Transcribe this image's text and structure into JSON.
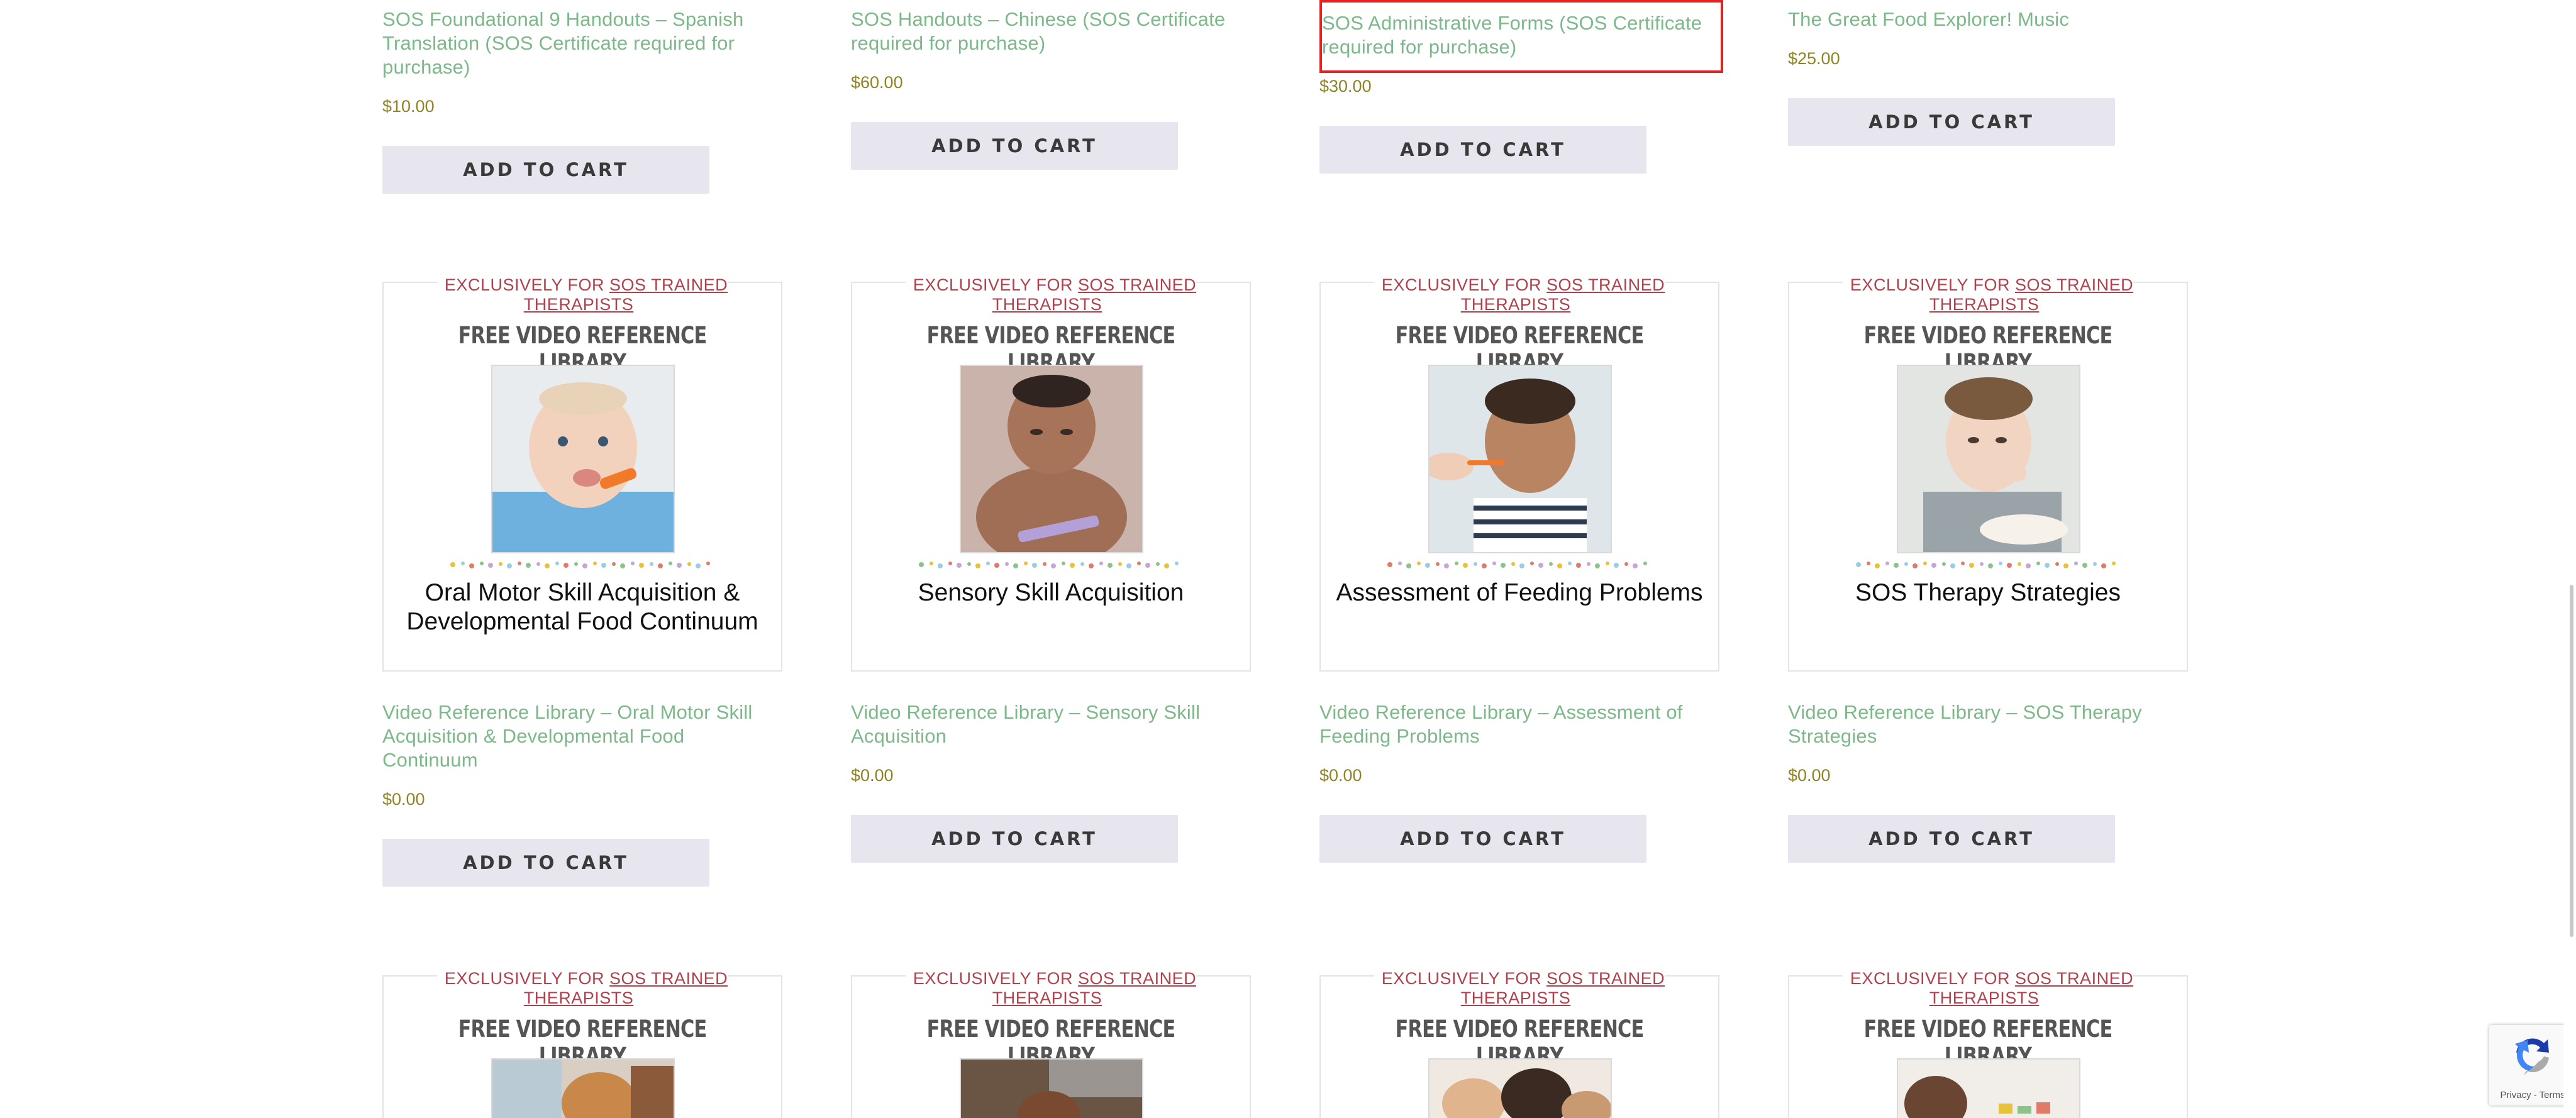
{
  "products_row1": [
    {
      "title": "SOS Foundational 9 Handouts – Spanish Translation (SOS Certificate required for purchase)",
      "price": "$10.00",
      "button": "ADD TO CART"
    },
    {
      "title": "SOS Handouts – Chinese (SOS Certificate required for purchase)",
      "price": "$60.00",
      "button": "ADD TO CART"
    },
    {
      "title": "SOS Administrative Forms (SOS Certificate required for purchase)",
      "price": "$30.00",
      "button": "ADD TO CART"
    },
    {
      "title": "The Great Food Explorer! Music",
      "price": "$25.00",
      "button": "ADD TO CART"
    }
  ],
  "products_row2": [
    {
      "exclusive_prefix": "EXCLUSIVELY FOR",
      "exclusive_link": "SOS TRAINED THERAPISTS",
      "library_title": "FREE VIDEO REFERENCE LIBRARY",
      "caption": "Oral Motor Skill Acquisition & Developmental Food Continuum",
      "title": "Video Reference Library – Oral Motor Skill Acquisition & Developmental Food Continuum",
      "price": "$0.00",
      "button": "ADD TO CART"
    },
    {
      "exclusive_prefix": "EXCLUSIVELY FOR",
      "exclusive_link": "SOS TRAINED THERAPISTS",
      "library_title": "FREE VIDEO REFERENCE LIBRARY",
      "caption": "Sensory Skill Acquisition",
      "title": "Video Reference Library – Sensory Skill Acquisition",
      "price": "$0.00",
      "button": "ADD TO CART"
    },
    {
      "exclusive_prefix": "EXCLUSIVELY FOR",
      "exclusive_link": "SOS TRAINED THERAPISTS",
      "library_title": "FREE VIDEO REFERENCE LIBRARY",
      "caption": "Assessment of Feeding Problems",
      "title": "Video Reference Library – Assessment of Feeding Problems",
      "price": "$0.00",
      "button": "ADD TO CART"
    },
    {
      "exclusive_prefix": "EXCLUSIVELY FOR",
      "exclusive_link": "SOS TRAINED THERAPISTS",
      "library_title": "FREE VIDEO REFERENCE LIBRARY",
      "caption": "SOS Therapy Strategies",
      "title": "Video Reference Library – SOS Therapy Strategies",
      "price": "$0.00",
      "button": "ADD TO CART"
    }
  ],
  "products_row3": [
    {
      "exclusive_prefix": "EXCLUSIVELY FOR",
      "exclusive_link": "SOS TRAINED THERAPISTS",
      "library_title": "FREE VIDEO REFERENCE LIBRARY"
    },
    {
      "exclusive_prefix": "EXCLUSIVELY FOR",
      "exclusive_link": "SOS TRAINED THERAPISTS",
      "library_title": "FREE VIDEO REFERENCE LIBRARY"
    },
    {
      "exclusive_prefix": "EXCLUSIVELY FOR",
      "exclusive_link": "SOS TRAINED THERAPISTS",
      "library_title": "FREE VIDEO REFERENCE LIBRARY"
    },
    {
      "exclusive_prefix": "EXCLUSIVELY FOR",
      "exclusive_link": "SOS TRAINED THERAPISTS",
      "library_title": "FREE VIDEO REFERENCE LIBRARY"
    }
  ],
  "recaptcha": {
    "links": "Privacy - Terms"
  },
  "colors": {
    "title_green": "#7db88b",
    "price_olive": "#8f8424",
    "button_bg": "#e7e5ee",
    "exclusive_red": "#b0414d",
    "highlight_red": "#e52222"
  },
  "icons": {
    "recaptcha": "recaptcha-logo-icon"
  }
}
